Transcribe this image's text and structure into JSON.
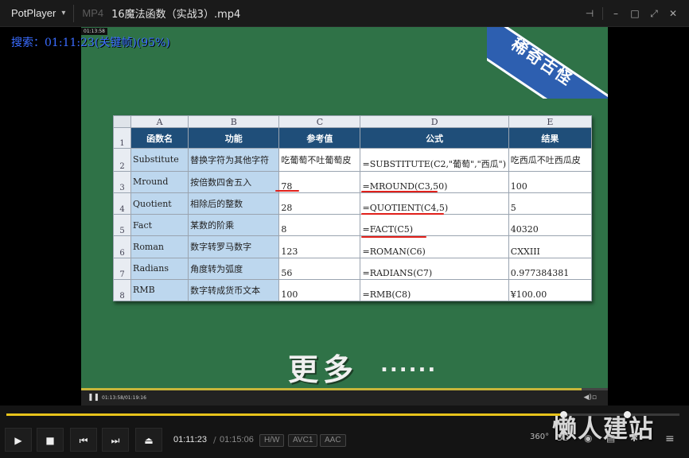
{
  "titlebar": {
    "app_name": "PotPlayer",
    "format": "MP4",
    "file_title": "16魔法函数（实战3）.mp4"
  },
  "osd": {
    "search_text": "搜索：01:11:23(关键帧)(95%)",
    "inner_tooltip_time": "01:13:58"
  },
  "video": {
    "banner_text": "稀奇古怪",
    "more_text": "更多",
    "more_dots": "......",
    "inner_time": "01:13:58/01:19:16"
  },
  "sheet": {
    "col_letters": [
      "A",
      "B",
      "C",
      "D",
      "E"
    ],
    "headers": [
      "函数名",
      "功能",
      "参考值",
      "公式",
      "结果"
    ],
    "rows": [
      {
        "num": "2",
        "name": "Substitute",
        "func": "替换字符为其他字符",
        "ref": "吃葡萄不吐葡萄皮",
        "formula": "=SUBSTITUTE(C2,\"葡萄\",\"西瓜\")",
        "result": "吃西瓜不吐西瓜皮"
      },
      {
        "num": "3",
        "name": "Mround",
        "func": "按倍数四舍五入",
        "ref": "78",
        "formula": "=MROUND(C3,50)",
        "result": "100"
      },
      {
        "num": "4",
        "name": "Quotient",
        "func": "相除后的整数",
        "ref": "28",
        "formula": "=QUOTIENT(C4,5)",
        "result": "5"
      },
      {
        "num": "5",
        "name": "Fact",
        "func": "某数的阶乘",
        "ref": "8",
        "formula": "=FACT(C5)",
        "result": "40320"
      },
      {
        "num": "6",
        "name": "Roman",
        "func": "数字转罗马数字",
        "ref": "123",
        "formula": "=ROMAN(C6)",
        "result": "CXXIII"
      },
      {
        "num": "7",
        "name": "Radians",
        "func": "角度转为弧度",
        "ref": "56",
        "formula": "=RADIANS(C7)",
        "result": "0.977384381"
      },
      {
        "num": "8",
        "name": "RMB",
        "func": "数字转成货币文本",
        "ref": "100",
        "formula": "=RMB(C8)",
        "result": "¥100.00"
      }
    ],
    "header_row_num": "1"
  },
  "controls": {
    "current_time": "01:11:23",
    "separator": "/",
    "total_time": "01:15:06",
    "tags": [
      "H/W",
      "AVC1",
      "AAC"
    ],
    "icons": [
      "play-icon",
      "stop-icon",
      "prev-icon",
      "next-icon",
      "eject-icon",
      "360-icon",
      "3d-icon",
      "capture-icon",
      "playlist-icon",
      "settings-icon",
      "menu-icon"
    ],
    "label_360": "360°",
    "label_3d": "3D",
    "progress": 0.83
  },
  "watermark": "懒人建站",
  "colors": {
    "video_bg": "#2f7247",
    "seek_fill": "#e7c31b",
    "osd_text": "#3a6cff",
    "header_fill": "#1f4e79",
    "cell_fill": "#bdd7ee"
  }
}
